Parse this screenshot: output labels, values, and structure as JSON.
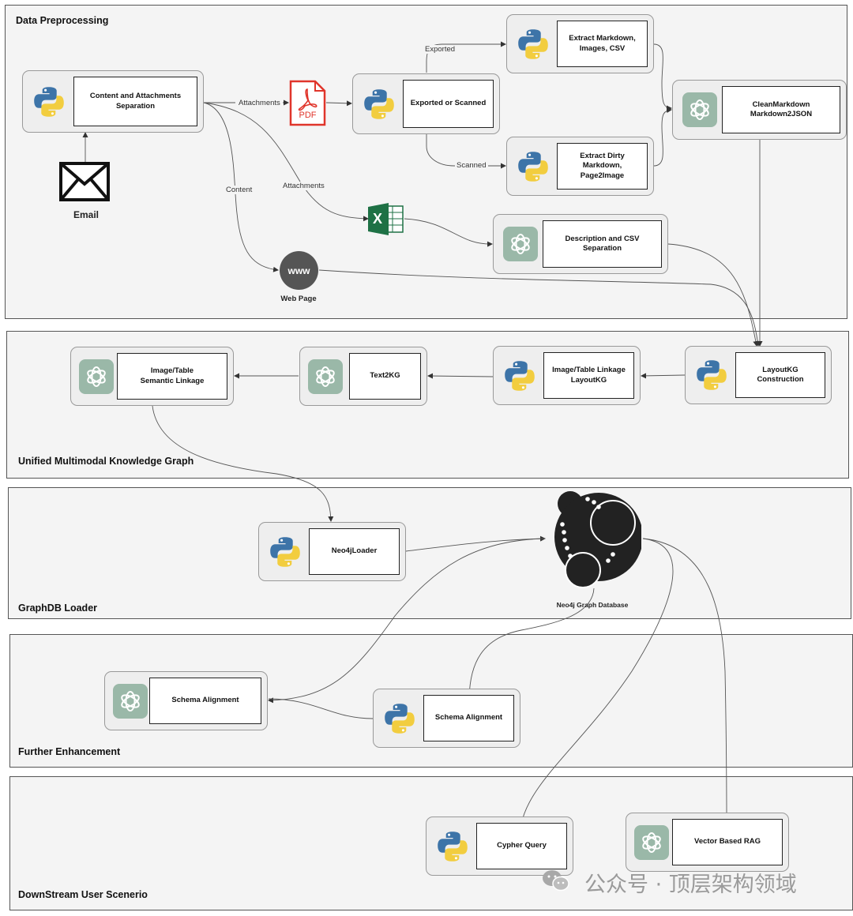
{
  "sections": {
    "data_preprocessing": "Data Preprocessing",
    "unified_kg": "Unified Multimodal Knowledge Graph",
    "graphdb_loader": "GraphDB Loader",
    "further_enhancement": "Further Enhancement",
    "downstream": "DownStream User Scenerio"
  },
  "nodes": {
    "content_separation": "Content and Attachments\nSeparation",
    "exported_or_scanned": "Exported or Scanned",
    "extract_markdown": "Extract Markdown,\nImages, CSV",
    "extract_dirty": "Extract Dirty\nMarkdown,\nPage2Image",
    "clean_markdown": "CleanMarkdown\nMarkdown2JSON",
    "description_csv": "Description and CSV\nSeparation",
    "layoutkg_construction": "LayoutKG\nConstruction",
    "image_table_linkage": "Image/Table Linkage\nLayoutKG",
    "text2kg": "Text2KG",
    "semantic_linkage": "Image/Table\nSemantic Linkage",
    "neo4j_loader": "Neo4jLoader",
    "schema_alignment_llm": "Schema Alignment",
    "schema_alignment_py": "Schema Alignment",
    "cypher_query": "Cypher Query",
    "vector_rag": "Vector Based RAG"
  },
  "captions": {
    "email": "Email",
    "web_page": "Web Page",
    "neo4j": "Neo4j Graph Database",
    "pdf": "PDF",
    "www": "www",
    "excel": "X"
  },
  "edge_labels": {
    "attachments_pdf": "Attachments",
    "attachments_excel": "Attachments",
    "content": "Content",
    "exported": "Exported",
    "scanned": "Scanned"
  },
  "watermark": "公众号 · 顶层架构领域",
  "colors": {
    "python_blue": "#3d74a8",
    "python_yellow": "#f2cd3f",
    "llm_bg": "#9ab8a8",
    "pdf_red": "#e0352b",
    "excel_green": "#1e7145"
  }
}
